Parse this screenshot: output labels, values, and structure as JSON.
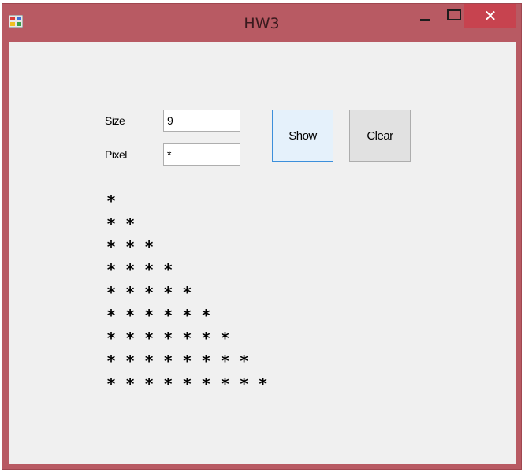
{
  "window": {
    "title": "HW3",
    "close_glyph": "✕",
    "frame_color": "#b85a63",
    "close_color": "#c7434f",
    "client_color": "#f0f0f0"
  },
  "form": {
    "size_label": "Size",
    "size_value": "9",
    "pixel_label": "Pixel",
    "pixel_value": "*",
    "show_label": "Show",
    "clear_label": "Clear"
  },
  "output": {
    "lines": [
      "*",
      "* *",
      "* * *",
      "* * * *",
      "* * * * *",
      "* * * * * *",
      "* * * * * * *",
      "* * * * * * * *",
      "* * * * * * * * *"
    ]
  },
  "icons": {
    "app": "app-icon",
    "minimize": "minimize-icon",
    "maximize": "maximize-icon",
    "close": "close-icon"
  }
}
